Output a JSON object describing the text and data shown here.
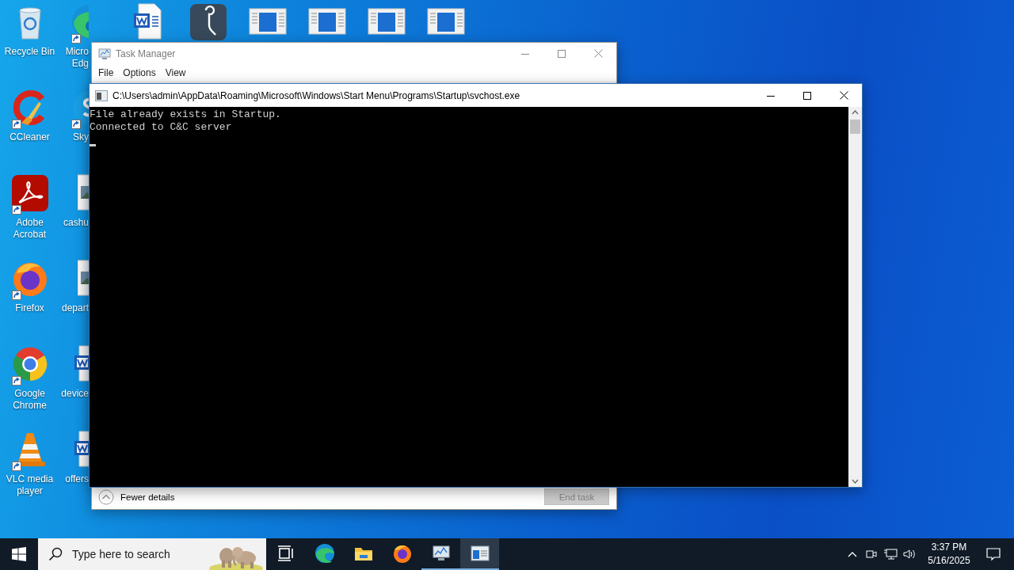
{
  "desktop": {
    "columns": [
      [
        {
          "kind": "recycle-bin",
          "lines": [
            "Recycle Bin"
          ]
        },
        {
          "kind": "ccleaner",
          "lines": [
            "CCleaner"
          ],
          "shortcut": true
        },
        {
          "kind": "acrobat",
          "lines": [
            "Adobe",
            "Acrobat"
          ],
          "shortcut": true
        },
        {
          "kind": "firefox",
          "lines": [
            "Firefox"
          ],
          "shortcut": true
        },
        {
          "kind": "chrome",
          "lines": [
            "Google",
            "Chrome"
          ],
          "shortcut": true
        },
        {
          "kind": "vlc",
          "lines": [
            "VLC media",
            "player"
          ],
          "shortcut": true
        }
      ],
      [
        {
          "kind": "edge",
          "lines": [
            "Micro",
            "Edg"
          ],
          "shortcut": true
        },
        {
          "kind": "skype",
          "lines": [
            "Sky"
          ],
          "shortcut": true
        },
        {
          "kind": "image-file",
          "lines": [
            "cashu"
          ]
        },
        {
          "kind": "image-file",
          "lines": [
            "depart"
          ]
        },
        {
          "kind": "word-file",
          "lines": [
            "device"
          ]
        },
        {
          "kind": "word-file",
          "lines": [
            "offers"
          ]
        }
      ],
      [
        {
          "kind": "word-file"
        }
      ],
      [
        {
          "kind": "app"
        }
      ],
      [
        {
          "kind": "window-file"
        }
      ],
      [
        {
          "kind": "window-file"
        }
      ],
      [
        {
          "kind": "window-file"
        }
      ],
      [
        {
          "kind": "window-file"
        }
      ]
    ]
  },
  "task_manager": {
    "title": "Task Manager",
    "active": false,
    "menu": [
      "File",
      "Options",
      "View"
    ],
    "footer": {
      "toggle": "Fewer details",
      "end_task": {
        "label": "End task",
        "disabled": true
      }
    }
  },
  "console": {
    "title": "C:\\Users\\admin\\AppData\\Roaming\\Microsoft\\Windows\\Start Menu\\Programs\\Startup\\svchost.exe",
    "active": true,
    "lines": [
      "File already exists in Startup.",
      "Connected to C&C server"
    ],
    "cursor": true
  },
  "taskbar": {
    "search": {
      "placeholder": "Type here to search"
    },
    "apps": [
      {
        "kind": "task-view",
        "running": false,
        "selected": false
      },
      {
        "kind": "edge",
        "running": false,
        "selected": false
      },
      {
        "kind": "explorer",
        "running": false,
        "selected": false
      },
      {
        "kind": "firefox",
        "running": false,
        "selected": false
      },
      {
        "kind": "task-manager",
        "running": true,
        "selected": false
      },
      {
        "kind": "console",
        "running": true,
        "selected": true
      }
    ],
    "tray": {
      "time": "3:37 PM",
      "date": "5/16/2025"
    }
  }
}
